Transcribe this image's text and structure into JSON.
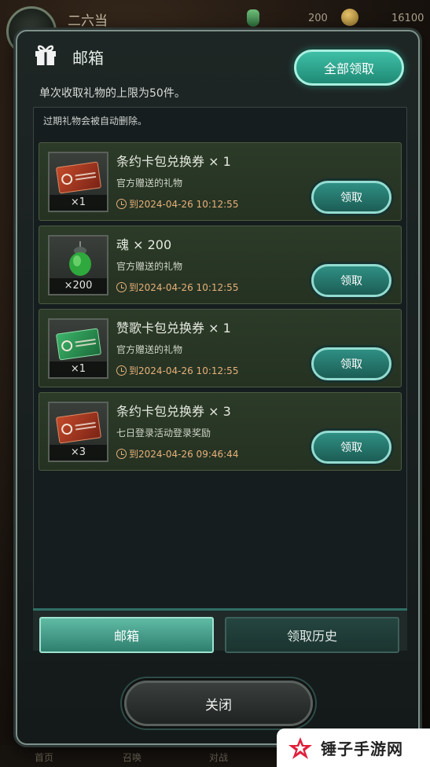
{
  "hud": {
    "player_name": "二六当",
    "soul_count": "200",
    "gold_count": "16100",
    "bottom_tabs": [
      "首页",
      "召唤",
      "对战"
    ]
  },
  "dialog": {
    "title": "邮箱",
    "claim_all_label": "全部领取",
    "limit_notice": "单次收取礼物的上限为50件。",
    "expire_notice": "过期礼物会被自动删除。",
    "items": [
      {
        "title": "条约卡包兑换券 × 1",
        "from": "官方赠送的礼物",
        "expiry": "到2024-04-26 10:12:55",
        "count": "×1",
        "icon": "red-ticket-icon",
        "claim_label": "领取"
      },
      {
        "title": "魂 × 200",
        "from": "官方赠送的礼物",
        "expiry": "到2024-04-26 10:12:55",
        "count": "×200",
        "icon": "soul-lantern-icon",
        "claim_label": "领取"
      },
      {
        "title": "赞歌卡包兑换券 × 1",
        "from": "官方赠送的礼物",
        "expiry": "到2024-04-26 10:12:55",
        "count": "×1",
        "icon": "green-ticket-icon",
        "claim_label": "领取"
      },
      {
        "title": "条约卡包兑换券 × 3",
        "from": "七日登录活动登录奖励",
        "expiry": "到2024-04-26 09:46:44",
        "count": "×3",
        "icon": "red-ticket-icon",
        "claim_label": "领取"
      }
    ],
    "tabs": {
      "mailbox": "邮箱",
      "history": "领取历史"
    },
    "close_label": "关闭"
  },
  "watermark": {
    "text": "锤子手游网"
  },
  "colors": {
    "accent": "#3fbfa6",
    "expiry": "#e7b07a",
    "panel": "#161d1e"
  }
}
